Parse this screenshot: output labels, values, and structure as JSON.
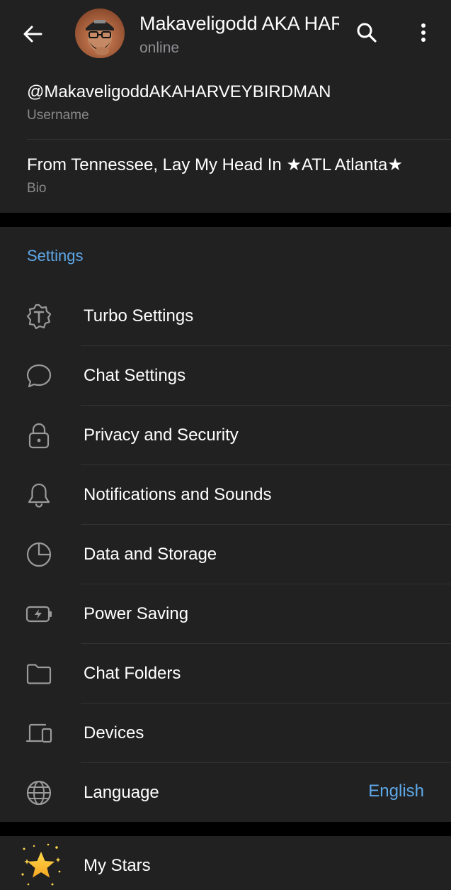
{
  "header": {
    "title": "Makaveligodd AKA HARVEY BIRDMAN",
    "status": "online"
  },
  "profile": {
    "username": "@MakaveligoddAKAHARVEYBIRDMAN",
    "username_label": "Username",
    "bio": "From Tennessee, Lay My Head In ★ATL Atlanta★",
    "bio_label": "Bio"
  },
  "settings": {
    "section_title": "Settings",
    "items": [
      {
        "label": "Turbo Settings",
        "icon": "turbo-icon"
      },
      {
        "label": "Chat Settings",
        "icon": "chat-bubble-icon"
      },
      {
        "label": "Privacy and Security",
        "icon": "lock-icon"
      },
      {
        "label": "Notifications and Sounds",
        "icon": "bell-icon"
      },
      {
        "label": "Data and Storage",
        "icon": "pie-chart-icon"
      },
      {
        "label": "Power Saving",
        "icon": "battery-bolt-icon"
      },
      {
        "label": "Chat Folders",
        "icon": "folder-icon"
      },
      {
        "label": "Devices",
        "icon": "devices-icon"
      },
      {
        "label": "Language",
        "icon": "globe-icon",
        "value": "English"
      }
    ]
  },
  "stars": {
    "label": "My Stars",
    "icon": "star-icon"
  },
  "colors": {
    "accent": "#5ea8e8",
    "surface": "#212121",
    "background": "#000000",
    "secondary_text": "#8a8a8a"
  }
}
